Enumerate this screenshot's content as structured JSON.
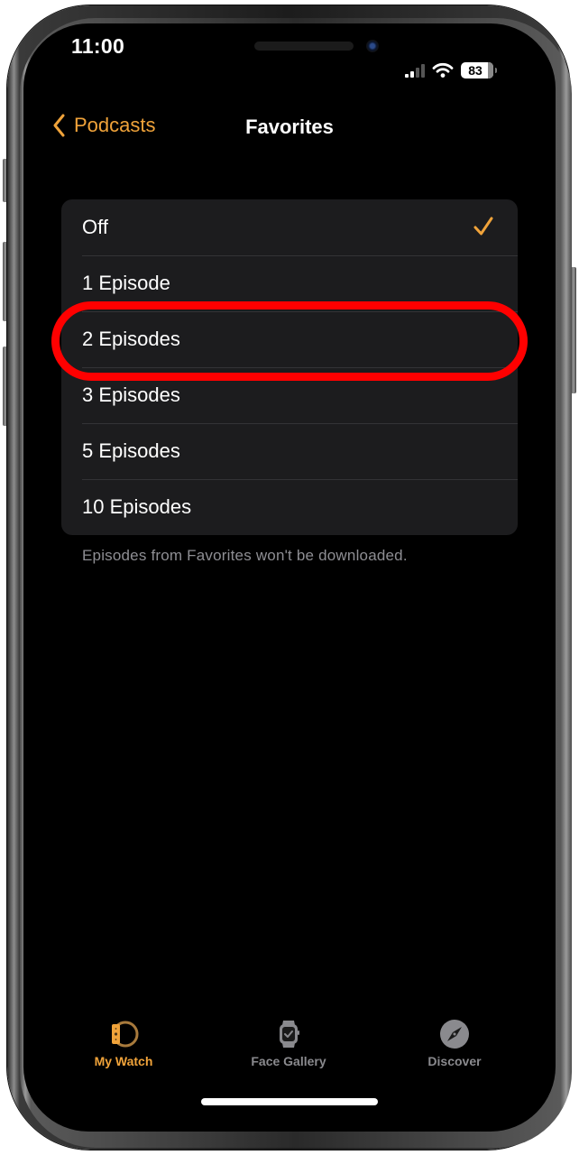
{
  "status_bar": {
    "time": "11:00",
    "battery_level": "83",
    "signal_bars_active": 2,
    "signal_bars_total": 4
  },
  "nav": {
    "back_label": "Podcasts",
    "title": "Favorites"
  },
  "options": {
    "items": [
      {
        "label": "Off",
        "selected": true
      },
      {
        "label": "1 Episode",
        "selected": false
      },
      {
        "label": "2 Episodes",
        "selected": false,
        "highlighted": true
      },
      {
        "label": "3 Episodes",
        "selected": false
      },
      {
        "label": "5 Episodes",
        "selected": false
      },
      {
        "label": "10 Episodes",
        "selected": false
      }
    ],
    "footnote": "Episodes from Favorites won't be downloaded."
  },
  "tabbar": {
    "items": [
      {
        "label": "My Watch",
        "icon": "watch-band-icon",
        "active": true
      },
      {
        "label": "Face Gallery",
        "icon": "watch-face-icon",
        "active": false
      },
      {
        "label": "Discover",
        "icon": "compass-icon",
        "active": false
      }
    ]
  },
  "colors": {
    "accent": "#f0a33a",
    "highlight_annotation": "#ff0000",
    "list_background": "#1c1c1e",
    "inactive_tab": "#8a8a8e"
  }
}
